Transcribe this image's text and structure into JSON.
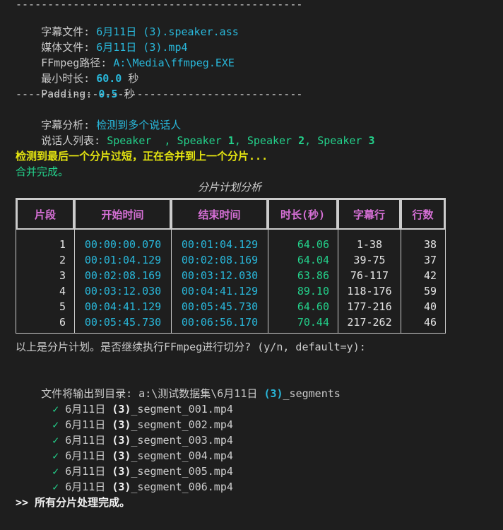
{
  "config": {
    "rule": "---------------------------------------------",
    "subtitle_label": "字幕文件: ",
    "subtitle_value": "6月11日 (3).speaker.ass",
    "media_label": "媒体文件: ",
    "media_value": "6月11日 (3).mp4",
    "ffmpeg_label": "FFmpeg路径: ",
    "ffmpeg_value": "A:\\Media\\ffmpeg.EXE",
    "min_label": "最小时长: ",
    "min_value": "60.0",
    "min_unit": " 秒",
    "padding_label": "Padding: ",
    "padding_value": "0.5",
    "padding_unit": " 秒"
  },
  "analysis": {
    "label": "字幕分析: ",
    "value": "检测到多个说话人",
    "speakers_label": "说话人列表: ",
    "speakers": [
      {
        "name": "Speaker ",
        "num": ""
      },
      {
        "name": "Speaker ",
        "num": "1"
      },
      {
        "name": "Speaker ",
        "num": "2"
      },
      {
        "name": "Speaker ",
        "num": "3"
      }
    ],
    "speaker_sep_first": " , ",
    "speaker_sep": ", "
  },
  "merge": {
    "warning": "检测到最后一个分片过短，正在合并到上一个分片...",
    "done": "合并完成。"
  },
  "plan": {
    "title": "分片计划分析",
    "headers": [
      "片段",
      "开始时间",
      "结束时间",
      "时长(秒)",
      "字幕行",
      "行数"
    ],
    "rows": [
      {
        "seg": "1",
        "start": "00:00:00.070",
        "end": "00:01:04.129",
        "dur": "64.06",
        "subs": "1-38",
        "count": "38"
      },
      {
        "seg": "2",
        "start": "00:01:04.129",
        "end": "00:02:08.169",
        "dur": "64.04",
        "subs": "39-75",
        "count": "37"
      },
      {
        "seg": "3",
        "start": "00:02:08.169",
        "end": "00:03:12.030",
        "dur": "63.86",
        "subs": "76-117",
        "count": "42"
      },
      {
        "seg": "4",
        "start": "00:03:12.030",
        "end": "00:04:41.129",
        "dur": "89.10",
        "subs": "118-176",
        "count": "59"
      },
      {
        "seg": "5",
        "start": "00:04:41.129",
        "end": "00:05:45.730",
        "dur": "64.60",
        "subs": "177-216",
        "count": "40"
      },
      {
        "seg": "6",
        "start": "00:05:45.730",
        "end": "00:06:56.170",
        "dur": "70.44",
        "subs": "217-262",
        "count": "46"
      }
    ]
  },
  "prompt": "以上是分片计划。是否继续执行FFmpeg进行切分? (y/n, default=y):",
  "output": {
    "dir_prefix": "文件将输出到目录: a:\\测试数据集\\6月11日 ",
    "dir_num": "(3)",
    "dir_suffix": "_segments",
    "check_glyph": "✓",
    "files": [
      {
        "pre": "6月11日 ",
        "num": "(3)",
        "post": "_segment_001.mp4"
      },
      {
        "pre": "6月11日 ",
        "num": "(3)",
        "post": "_segment_002.mp4"
      },
      {
        "pre": "6月11日 ",
        "num": "(3)",
        "post": "_segment_003.mp4"
      },
      {
        "pre": "6月11日 ",
        "num": "(3)",
        "post": "_segment_004.mp4"
      },
      {
        "pre": "6月11日 ",
        "num": "(3)",
        "post": "_segment_005.mp4"
      },
      {
        "pre": "6月11日 ",
        "num": "(3)",
        "post": "_segment_006.mp4"
      }
    ]
  },
  "final": ">> 所有分片处理完成。",
  "colors": {
    "background": "#1e1e1e",
    "cyan": "#29b8db",
    "green": "#23d18b",
    "yellow": "#e5e510",
    "magenta": "#d670d6"
  }
}
